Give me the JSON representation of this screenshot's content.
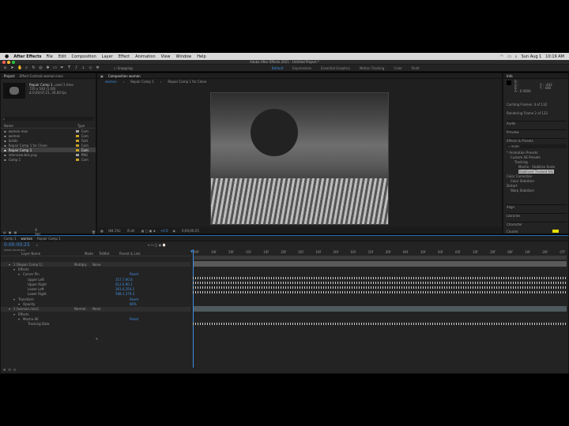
{
  "menubar": {
    "apple": "",
    "app": "After Effects",
    "items": [
      "File",
      "Edit",
      "Composition",
      "Layer",
      "Effect",
      "Animation",
      "View",
      "Window",
      "Help"
    ],
    "date": "Sun Aug 1",
    "time": "10:19 AM"
  },
  "titlebar": {
    "title": "Adobe After Effects 2021 - Untitled Project *"
  },
  "toolbar": {
    "snapping": "Snapping",
    "workspaces": [
      "Default",
      "Expressions",
      "Essential Graphics",
      "Motion Tracking",
      "Color",
      "Paint"
    ],
    "active_workspace": "Default"
  },
  "project": {
    "tab": "Project",
    "effects_tab": "Effect Controls woman.mov",
    "selected_name": "Repair Comp 1",
    "selected_used": ", used 1 time",
    "selected_size": "720 x 540 (1.00)",
    "selected_duration": "Δ 0;00;07;21, 30.00 fps",
    "search_placeholder": "",
    "col_name": "Name",
    "col_type": "Type",
    "items": [
      {
        "name": "woman.mov",
        "type": "Com",
        "color": "#a1a1a1"
      },
      {
        "name": "woman",
        "type": "Com",
        "color": "#c9a227"
      },
      {
        "name": "Solids",
        "type": "Fold",
        "color": "#c9a227"
      },
      {
        "name": "Repair Comp 1 for Clone",
        "type": "Com",
        "color": "#c9a227"
      },
      {
        "name": "Repair Comp 1",
        "type": "Com",
        "color": "#c9a227",
        "selected": true
      },
      {
        "name": "interview-bck.png",
        "type": "PNG",
        "color": "#a1a1a1"
      },
      {
        "name": "Comp 1",
        "type": "Com",
        "color": "#c9a227"
      }
    ],
    "bpc": "8 bpc"
  },
  "composition": {
    "tab": "Composition woman",
    "flow": [
      "woman",
      "Repair Comp 1",
      "Repair Comp 1 for Clone"
    ],
    "zoom": "(84.1%)",
    "quality": "(Full)",
    "timecode": "0;00;00;25",
    "exposure": "+0.0"
  },
  "right": {
    "info": "Info",
    "r": "R :",
    "g": "G :",
    "b": "B :",
    "a": "A : 0.0000",
    "x": "X : -403",
    "y": "Y : 448",
    "caching": "Caching Frames: 4 of 132",
    "rendering": "Rendering Frame 2 of 132",
    "audio": "Audio",
    "preview": "Preview",
    "effects_presets": "Effects & Presets",
    "search": "mate",
    "tree": [
      {
        "label": "* Animation Presets",
        "indent": 0
      },
      {
        "label": "Custom AE Presets",
        "indent": 1
      },
      {
        "label": "Tracking",
        "indent": 2
      },
      {
        "label": "Mocha - Stabilize Scale",
        "indent": 3
      },
      {
        "label": "Stabilized Tracked 6dc",
        "indent": 3,
        "selected": true
      },
      {
        "label": "Color Correction",
        "indent": 0
      },
      {
        "label": "Color Stabilizer",
        "indent": 1
      },
      {
        "label": "Distort",
        "indent": 0
      },
      {
        "label": "Warp Stabilizer",
        "indent": 1
      }
    ],
    "align": "Align",
    "libraries": "Libraries",
    "character": "Character",
    "font": "Courier"
  },
  "timeline": {
    "tabs": [
      "Comp 1",
      "woman",
      "Repair Comp 1"
    ],
    "active_tab": "woman",
    "timecode": "0:00:00:25",
    "frameinfo": "00025 (30.00 fps)",
    "cols": {
      "source": "Layer Name",
      "mode": "Mode",
      "trkmat": "TrkMat",
      "parent": "Parent & Link"
    },
    "rows": [
      {
        "text": "1  [Repair Comp 1]",
        "indent": 0,
        "mode": "Multiply",
        "parent": "None",
        "value": ""
      },
      {
        "text": "Effects",
        "indent": 1,
        "value": ""
      },
      {
        "text": "Corner Pin",
        "indent": 2,
        "value": "Reset"
      },
      {
        "text": "Upper Left",
        "indent": 3,
        "value": "357.7,90.8"
      },
      {
        "text": "Upper Right",
        "indent": 3,
        "value": "612.6,90.1"
      },
      {
        "text": "Lower Left",
        "indent": 3,
        "value": "361.6,354.1"
      },
      {
        "text": "Lower Right",
        "indent": 3,
        "value": "588.1,379.3"
      },
      {
        "text": "Transform",
        "indent": 1,
        "value": "Reset"
      },
      {
        "text": "Opacity",
        "indent": 2,
        "value": "86%"
      },
      {
        "text": "2  [woman.mov]",
        "indent": 0,
        "mode": "Normal",
        "parent": "None",
        "value": ""
      },
      {
        "text": "Effects",
        "indent": 1,
        "value": ""
      },
      {
        "text": "Mocha AE",
        "indent": 2,
        "value": "Reset"
      },
      {
        "text": "Tracking Data",
        "indent": 3,
        "value": ""
      }
    ],
    "ruler": [
      "00f",
      "10f",
      "20f",
      "01f",
      "10f",
      "20f",
      "02f",
      "10f",
      "20f",
      "03f",
      "10f",
      "20f",
      "04f",
      "10f",
      "20f",
      "05f",
      "10f",
      "20f",
      "06f",
      "10f",
      "20f",
      "07f"
    ]
  }
}
